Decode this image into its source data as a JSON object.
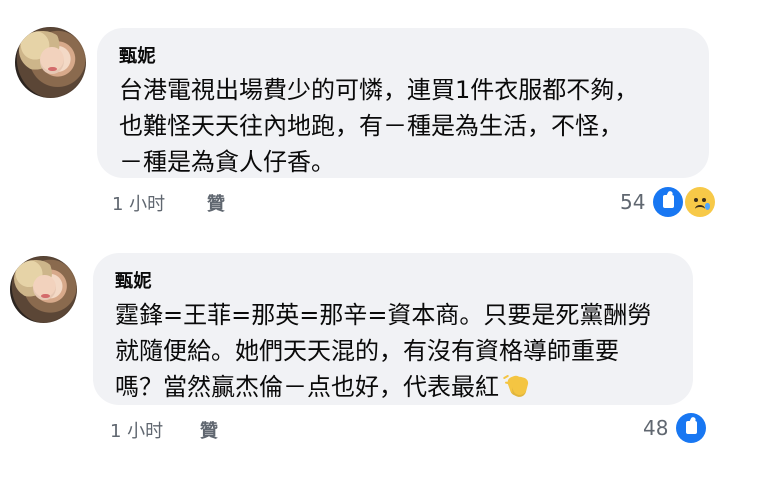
{
  "comments": [
    {
      "author": "甄妮",
      "text": "台港電視出場費少的可憐，連買1件衣服都不夠，\n也難怪天天往內地跑，有－種是為生活，不怪，\n－種是為貪人仔香。",
      "time": "1 小时",
      "like_label": "贊",
      "reaction_count": "54",
      "reaction_icons": [
        "like-icon",
        "sad-icon"
      ]
    },
    {
      "author": "甄妮",
      "text": "霆鋒=王菲=那英=那辛=資本商。只要是死黨酬勞\n就隨便給。她們天天混的，有沒有資格導師重要\n嗎？當然贏杰倫－点也好，代表最紅",
      "time": "1 小时",
      "like_label": "贊",
      "reaction_count": "48",
      "reaction_icons": [
        "like-icon"
      ],
      "trailing_emoji": "clap-icon"
    }
  ],
  "colors": {
    "bubble_bg": "#f1f2f5",
    "meta_text": "#606770",
    "like_blue": "#1877f2",
    "sad_yellow": "#f7c948"
  }
}
